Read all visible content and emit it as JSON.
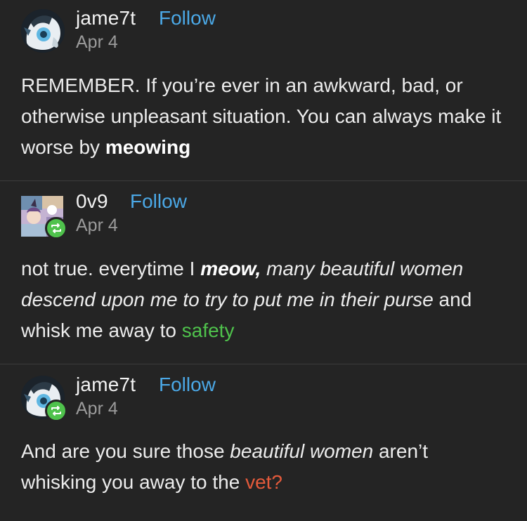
{
  "posts": [
    {
      "username": "jame7t",
      "follow_label": "Follow",
      "date": "Apr 4",
      "body": {
        "p1": "REMEMBER. If you’re ever in an awkward, bad, or otherwise unpleasant situation. You can always make it worse by ",
        "p2_bold": "meowing"
      }
    },
    {
      "username": "0v9",
      "follow_label": "Follow",
      "date": "Apr 4",
      "body": {
        "p1": "not true. everytime I ",
        "p2_bold_italic": "meow,",
        "p3_italic": " many beautiful women descend upon me to try to put me in their ",
        "p4_italic": "purse",
        "p5": " and whisk me away to ",
        "p6_link": "safety"
      }
    },
    {
      "username": "jame7t",
      "follow_label": "Follow",
      "date": "Apr 4",
      "body": {
        "p1": "And are you sure those ",
        "p2_italic": "beautiful women",
        "p3": " aren’t whisking you away to the ",
        "p4_colored": "vet?"
      }
    }
  ],
  "colors": {
    "background": "#242424",
    "follow": "#4ba8e6",
    "reblog_badge": "#4fc24c",
    "green_text": "#4fc24c",
    "red_text": "#e45a3b"
  },
  "icons": {
    "avatar_1": "anime-character-avatar-icon",
    "avatar_2": "anime-collage-avatar-icon",
    "reblog": "reblog-icon"
  }
}
